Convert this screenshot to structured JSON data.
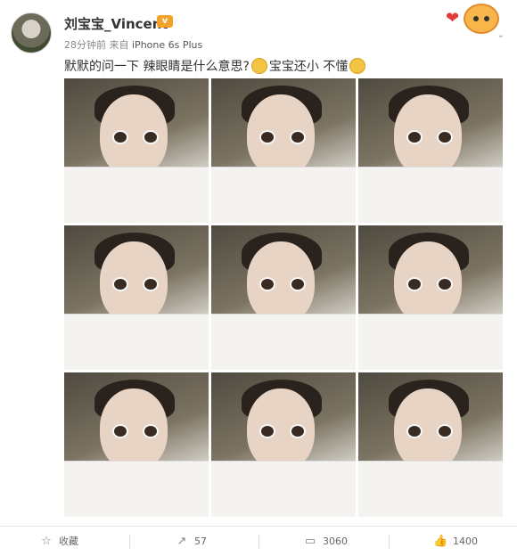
{
  "post": {
    "username": "刘宝宝_Vincent",
    "vip_badge": "v",
    "time": "28分钟前",
    "source_prefix": "来自",
    "source": "iPhone 6s Plus",
    "text_part1": "默默的问一下 辣眼睛是什么意思?",
    "text_part2": "宝宝还小 不懂",
    "emoji_icon": "cat-face-icon",
    "photos_count": 9
  },
  "actions": {
    "favorite_label": "收藏",
    "repost_count": "57",
    "comment_count": "3060",
    "like_count": "1400"
  },
  "icons": {
    "favorite": "star-icon",
    "repost": "repost-icon",
    "comment": "comment-icon",
    "like": "thumbs-up-icon"
  }
}
